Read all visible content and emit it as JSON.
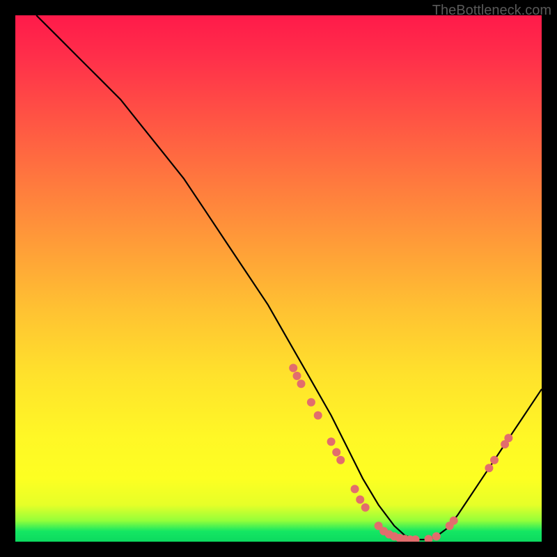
{
  "attribution": "TheBottleneck.com",
  "chart_data": {
    "type": "line",
    "title": "",
    "xlabel": "",
    "ylabel": "",
    "xlim": [
      0,
      100
    ],
    "ylim": [
      0,
      100
    ],
    "series": [
      {
        "name": "bottleneck-curve",
        "x": [
          4,
          8,
          12,
          16,
          20,
          24,
          28,
          32,
          36,
          40,
          44,
          48,
          52,
          56,
          60,
          63,
          66,
          69,
          72,
          74,
          76,
          78,
          80,
          82,
          84,
          86,
          88,
          90,
          92,
          94,
          96,
          100
        ],
        "y": [
          100,
          96,
          92,
          88,
          84,
          79,
          74,
          69,
          63,
          57,
          51,
          45,
          38,
          31,
          24,
          18,
          12,
          7,
          3,
          1.2,
          0.4,
          0.4,
          1,
          2.5,
          5,
          8,
          11,
          14,
          17,
          20,
          23,
          29
        ]
      }
    ],
    "dots": {
      "name": "highlight-markers",
      "points": [
        {
          "x": 52.8,
          "y": 33
        },
        {
          "x": 53.5,
          "y": 31.5
        },
        {
          "x": 54.3,
          "y": 30
        },
        {
          "x": 56.2,
          "y": 26.5
        },
        {
          "x": 57.5,
          "y": 24
        },
        {
          "x": 60,
          "y": 19
        },
        {
          "x": 61,
          "y": 17
        },
        {
          "x": 61.8,
          "y": 15.5
        },
        {
          "x": 64.5,
          "y": 10
        },
        {
          "x": 65.5,
          "y": 8
        },
        {
          "x": 66.5,
          "y": 6.5
        },
        {
          "x": 69,
          "y": 3
        },
        {
          "x": 70,
          "y": 2
        },
        {
          "x": 71,
          "y": 1.4
        },
        {
          "x": 72,
          "y": 1
        },
        {
          "x": 73,
          "y": 0.7
        },
        {
          "x": 74,
          "y": 0.5
        },
        {
          "x": 75,
          "y": 0.4
        },
        {
          "x": 76,
          "y": 0.4
        },
        {
          "x": 78.5,
          "y": 0.5
        },
        {
          "x": 80,
          "y": 1
        },
        {
          "x": 82.5,
          "y": 3
        },
        {
          "x": 83.3,
          "y": 4
        },
        {
          "x": 90,
          "y": 14
        },
        {
          "x": 91,
          "y": 15.5
        },
        {
          "x": 93,
          "y": 18.5
        },
        {
          "x": 93.7,
          "y": 19.7
        }
      ]
    }
  }
}
